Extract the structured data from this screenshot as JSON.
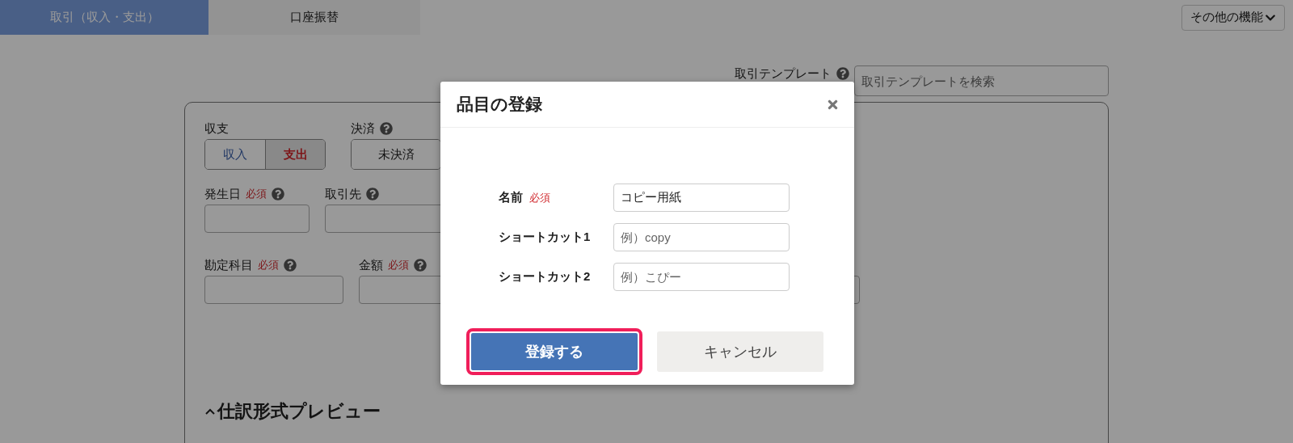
{
  "tabs": [
    {
      "label": "取引（収入・支出）",
      "selected": true
    },
    {
      "label": "口座振替",
      "selected": false
    }
  ],
  "more_menu": {
    "label": "その他の機能"
  },
  "template": {
    "label": "取引テンプレート",
    "placeholder": "取引テンプレートを検索"
  },
  "form": {
    "income_expense": {
      "label": "収支",
      "options": [
        {
          "label": "収入",
          "selected": false,
          "kind": "income"
        },
        {
          "label": "支出",
          "selected": true,
          "kind": "expense"
        }
      ]
    },
    "settlement": {
      "label": "決済",
      "options": [
        {
          "label": "未決済",
          "selected": false
        }
      ]
    },
    "rows": [
      [
        {
          "kind": "labeled",
          "label": "発生日",
          "required": "必須"
        },
        {
          "kind": "labeled",
          "label": "取引先"
        }
      ],
      [
        {
          "kind": "labeled",
          "label": "勘定科目",
          "required": "必須"
        },
        {
          "kind": "labeled",
          "label": "金額",
          "required": "必須"
        },
        {
          "kind": "input"
        }
      ]
    ]
  },
  "preview": {
    "title": "仕訳形式プレビュー",
    "expanded": true
  },
  "dialog": {
    "title": "品目の登録",
    "fields": [
      {
        "label": "名前",
        "required": "必須",
        "value": "コピー用紙"
      },
      {
        "label": "ショートカット1",
        "placeholder": "例）copy"
      },
      {
        "label": "ショートカット2",
        "placeholder": "例）こぴー"
      }
    ],
    "buttons": [
      {
        "label": "登録する",
        "kind": "primary",
        "focused": true
      },
      {
        "label": "キャンセル",
        "kind": "secondary",
        "focused": false
      }
    ]
  }
}
